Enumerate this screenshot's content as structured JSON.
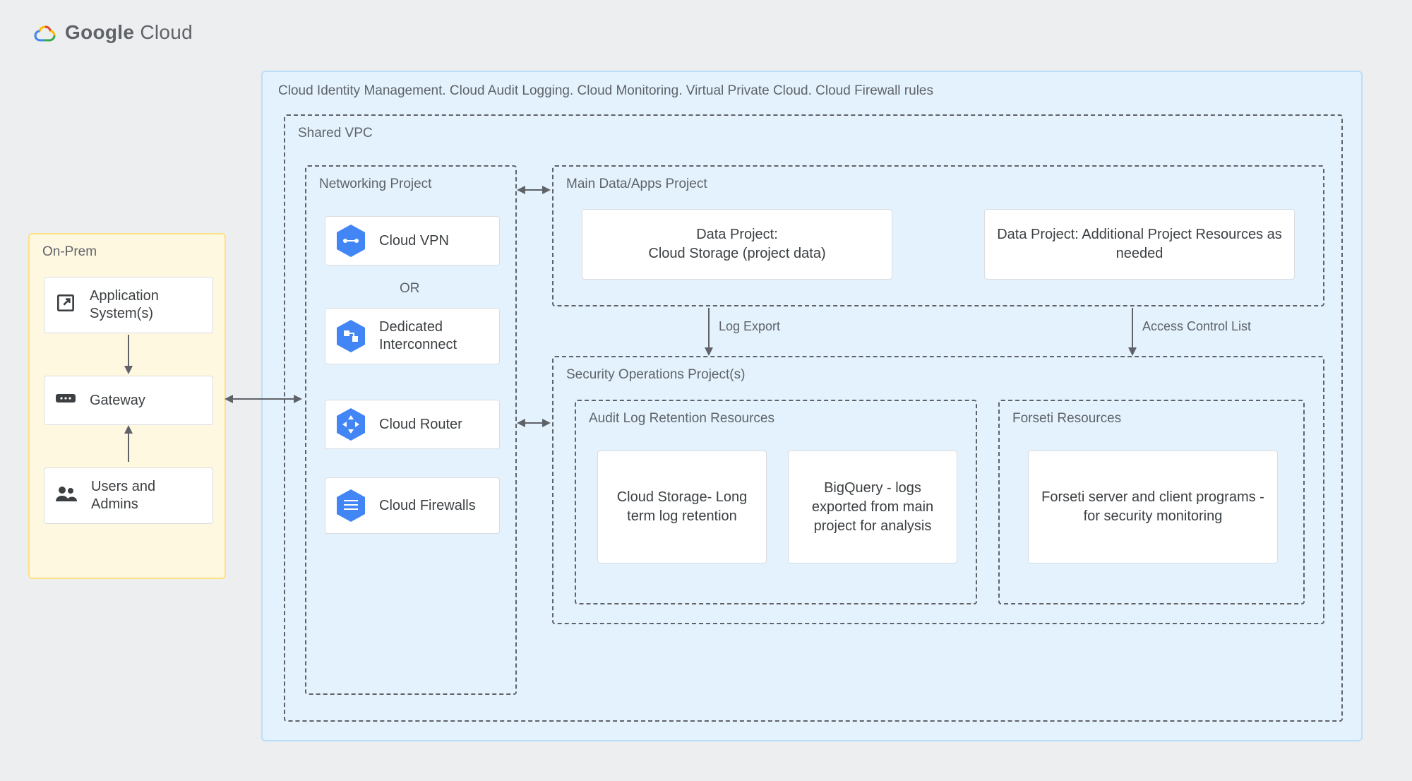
{
  "logo": {
    "word_bold": "Google",
    "word_light": " Cloud"
  },
  "cloud": {
    "caption": "Cloud Identity Management. Cloud Audit Logging. Cloud Monitoring. Virtual Private Cloud. Cloud Firewall rules"
  },
  "shared_vpc": {
    "label": "Shared VPC"
  },
  "networking": {
    "label": "Networking Project",
    "cloud_vpn": "Cloud VPN",
    "or": "OR",
    "dedicated": "Dedicated Interconnect",
    "router": "Cloud Router",
    "firewalls": "Cloud Firewalls"
  },
  "main_proj": {
    "label": "Main Data/Apps Project",
    "storage": "Data Project:\nCloud Storage (project data)",
    "resources": "Data Project: Additional Project  Resources as needed"
  },
  "secops": {
    "label": "Security Operations Project(s)",
    "audit": {
      "label": "Audit Log Retention Resources",
      "cs": "Cloud Storage- Long term log retention",
      "bq": "BigQuery - logs exported from main project for analysis"
    },
    "forseti": {
      "label": "Forseti Resources",
      "box": "Forseti server and client programs - for security monitoring"
    }
  },
  "edges": {
    "log_export": "Log Export",
    "acl": "Access Control List"
  },
  "onprem": {
    "label": "On-Prem",
    "app": "Application System(s)",
    "gw": "Gateway",
    "users": "Users and Admins"
  }
}
